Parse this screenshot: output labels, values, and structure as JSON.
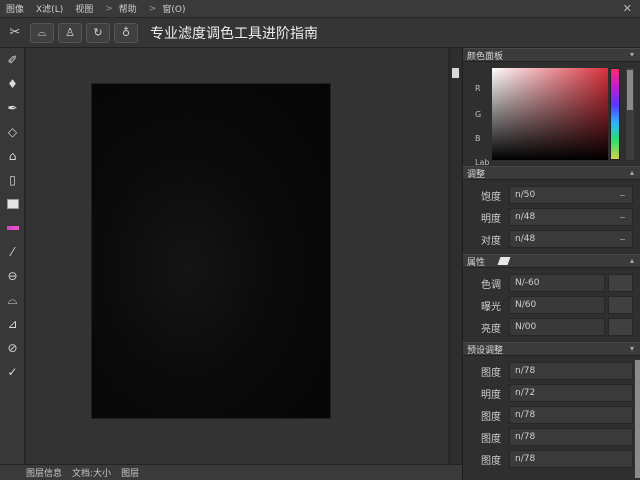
{
  "menu": {
    "items": [
      "图像",
      "X滤(L)",
      "视图",
      ">",
      "帮助",
      ">",
      "窗(O)"
    ]
  },
  "options_bar": {
    "title": "专业滤度调色工具进阶指南"
  },
  "status_bar": {
    "items": [
      "图层信息",
      "文档:大小",
      "图层"
    ]
  },
  "panels": {
    "color": {
      "title": "颜色面板",
      "side_labels": [
        "R",
        "G",
        "B",
        "Lab"
      ]
    },
    "adjust": {
      "title": "调整",
      "rows": [
        {
          "label": "饱度",
          "value": "n/50"
        },
        {
          "label": "明度",
          "value": "n/48"
        },
        {
          "label": "对度",
          "value": "n/48"
        }
      ]
    },
    "properties": {
      "title": "属性",
      "rows": [
        {
          "label": "色调",
          "value": "N/-60"
        },
        {
          "label": "曝光",
          "value": "N/60"
        },
        {
          "label": "亮度",
          "value": "N/00"
        }
      ]
    },
    "presets": {
      "title": "预设调整",
      "rows": [
        {
          "label": "图度",
          "value": "n/78"
        },
        {
          "label": "明度",
          "value": "n/72"
        },
        {
          "label": "图度",
          "value": "n/78"
        },
        {
          "label": "图度",
          "value": "n/78"
        },
        {
          "label": "图度",
          "value": "n/78"
        }
      ]
    }
  },
  "icons": {
    "toolbar": [
      "brush-icon",
      "drop-icon",
      "pen-icon",
      "tag-icon",
      "bucket-icon",
      "stamp-icon",
      "rectangle-icon",
      "swatch-icon",
      "pipette-icon",
      "eraser-icon",
      "history-icon",
      "burn-icon",
      "dodge-icon"
    ]
  }
}
